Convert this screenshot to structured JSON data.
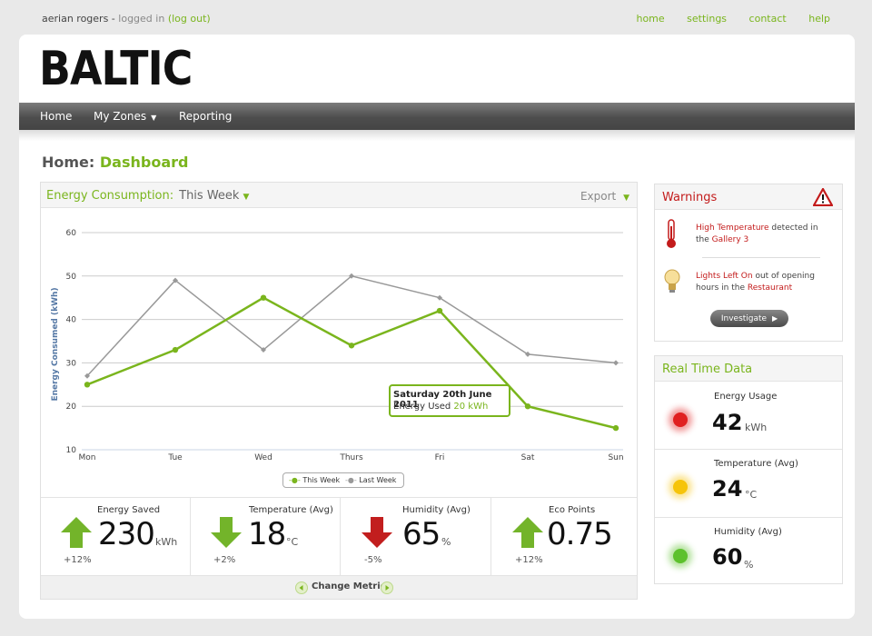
{
  "user": {
    "name": "aerian rogers",
    "sep": " - ",
    "status": "logged in",
    "logout": "(log out)"
  },
  "toplinks": [
    "home",
    "settings",
    "contact",
    "help"
  ],
  "brand": {
    "logo": "BALTIC",
    "accent": "#7ab51d",
    "alert": "#c31b1b"
  },
  "nav": {
    "items": [
      {
        "label": "Home"
      },
      {
        "label": "My Zones"
      },
      {
        "label": "Reporting"
      }
    ]
  },
  "breadcrumb": {
    "root": "Home:",
    "current": "Dashboard"
  },
  "energy": {
    "title": "Energy Consumption:",
    "period": "This Week",
    "export": "Export",
    "tooltip": {
      "date": "Saturday 20th June 2011",
      "label": "Energy Used",
      "value": "20 kWh"
    },
    "legend": [
      "This Week",
      "Last Week"
    ],
    "change_metric": "Change Metric"
  },
  "chart_data": {
    "type": "line",
    "ylabel": "Energy Consumed (kWh)",
    "ylim": [
      10,
      60
    ],
    "yticks": [
      "10",
      "20",
      "30",
      "40",
      "50",
      "60"
    ],
    "categories": [
      "Mon",
      "Tue",
      "Wed",
      "Thurs",
      "Fri",
      "Sat",
      "Sun"
    ],
    "series": [
      {
        "name": "This Week",
        "color": "#7ab51d",
        "values": [
          25,
          33,
          45,
          34,
          42,
          20,
          15
        ]
      },
      {
        "name": "Last Week",
        "color": "#999999",
        "values": [
          27,
          49,
          33,
          50,
          45,
          32,
          30
        ]
      }
    ],
    "grid": true,
    "legend_position": "bottom"
  },
  "metrics": [
    {
      "label": "Energy Saved",
      "value": "230",
      "unit": "kWh",
      "delta": "+12%",
      "trend": "up"
    },
    {
      "label": "Temperature (Avg)",
      "value": "18",
      "unit": "°C",
      "delta": "+2%",
      "trend": "down"
    },
    {
      "label": "Humidity (Avg)",
      "value": "65",
      "unit": "%",
      "delta": "-5%",
      "trend": "down-red"
    },
    {
      "label": "Eco Points",
      "value": "0.75",
      "unit": "",
      "delta": "+12%",
      "trend": "up"
    }
  ],
  "warnings": {
    "title": "Warnings",
    "items": [
      {
        "icon": "thermometer-icon",
        "a": "High Temperature",
        "b": " detected in the ",
        "c": "Gallery 3"
      },
      {
        "icon": "lightbulb-icon",
        "a": "Lights Left On",
        "b": " out of opening hours in the ",
        "c": "Restaurant"
      }
    ],
    "button": "Investigate"
  },
  "realtime": {
    "title": "Real Time Data",
    "items": [
      {
        "label": "Energy Usage",
        "value": "42",
        "unit": "kWh",
        "color": "#e02020"
      },
      {
        "label": "Temperature (Avg)",
        "value": "24",
        "unit": "°C",
        "color": "#f6c40a"
      },
      {
        "label": "Humidity (Avg)",
        "value": "60",
        "unit": "%",
        "color": "#5dc12d"
      }
    ]
  }
}
